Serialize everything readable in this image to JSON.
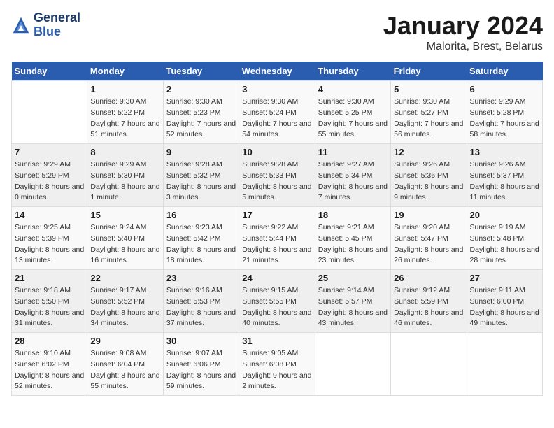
{
  "header": {
    "logo_line1": "General",
    "logo_line2": "Blue",
    "month": "January 2024",
    "location": "Malorita, Brest, Belarus"
  },
  "weekdays": [
    "Sunday",
    "Monday",
    "Tuesday",
    "Wednesday",
    "Thursday",
    "Friday",
    "Saturday"
  ],
  "weeks": [
    [
      {
        "day": "",
        "sunrise": "",
        "sunset": "",
        "daylight": ""
      },
      {
        "day": "1",
        "sunrise": "Sunrise: 9:30 AM",
        "sunset": "Sunset: 5:22 PM",
        "daylight": "Daylight: 7 hours and 51 minutes."
      },
      {
        "day": "2",
        "sunrise": "Sunrise: 9:30 AM",
        "sunset": "Sunset: 5:23 PM",
        "daylight": "Daylight: 7 hours and 52 minutes."
      },
      {
        "day": "3",
        "sunrise": "Sunrise: 9:30 AM",
        "sunset": "Sunset: 5:24 PM",
        "daylight": "Daylight: 7 hours and 54 minutes."
      },
      {
        "day": "4",
        "sunrise": "Sunrise: 9:30 AM",
        "sunset": "Sunset: 5:25 PM",
        "daylight": "Daylight: 7 hours and 55 minutes."
      },
      {
        "day": "5",
        "sunrise": "Sunrise: 9:30 AM",
        "sunset": "Sunset: 5:27 PM",
        "daylight": "Daylight: 7 hours and 56 minutes."
      },
      {
        "day": "6",
        "sunrise": "Sunrise: 9:29 AM",
        "sunset": "Sunset: 5:28 PM",
        "daylight": "Daylight: 7 hours and 58 minutes."
      }
    ],
    [
      {
        "day": "7",
        "sunrise": "Sunrise: 9:29 AM",
        "sunset": "Sunset: 5:29 PM",
        "daylight": "Daylight: 8 hours and 0 minutes."
      },
      {
        "day": "8",
        "sunrise": "Sunrise: 9:29 AM",
        "sunset": "Sunset: 5:30 PM",
        "daylight": "Daylight: 8 hours and 1 minute."
      },
      {
        "day": "9",
        "sunrise": "Sunrise: 9:28 AM",
        "sunset": "Sunset: 5:32 PM",
        "daylight": "Daylight: 8 hours and 3 minutes."
      },
      {
        "day": "10",
        "sunrise": "Sunrise: 9:28 AM",
        "sunset": "Sunset: 5:33 PM",
        "daylight": "Daylight: 8 hours and 5 minutes."
      },
      {
        "day": "11",
        "sunrise": "Sunrise: 9:27 AM",
        "sunset": "Sunset: 5:34 PM",
        "daylight": "Daylight: 8 hours and 7 minutes."
      },
      {
        "day": "12",
        "sunrise": "Sunrise: 9:26 AM",
        "sunset": "Sunset: 5:36 PM",
        "daylight": "Daylight: 8 hours and 9 minutes."
      },
      {
        "day": "13",
        "sunrise": "Sunrise: 9:26 AM",
        "sunset": "Sunset: 5:37 PM",
        "daylight": "Daylight: 8 hours and 11 minutes."
      }
    ],
    [
      {
        "day": "14",
        "sunrise": "Sunrise: 9:25 AM",
        "sunset": "Sunset: 5:39 PM",
        "daylight": "Daylight: 8 hours and 13 minutes."
      },
      {
        "day": "15",
        "sunrise": "Sunrise: 9:24 AM",
        "sunset": "Sunset: 5:40 PM",
        "daylight": "Daylight: 8 hours and 16 minutes."
      },
      {
        "day": "16",
        "sunrise": "Sunrise: 9:23 AM",
        "sunset": "Sunset: 5:42 PM",
        "daylight": "Daylight: 8 hours and 18 minutes."
      },
      {
        "day": "17",
        "sunrise": "Sunrise: 9:22 AM",
        "sunset": "Sunset: 5:44 PM",
        "daylight": "Daylight: 8 hours and 21 minutes."
      },
      {
        "day": "18",
        "sunrise": "Sunrise: 9:21 AM",
        "sunset": "Sunset: 5:45 PM",
        "daylight": "Daylight: 8 hours and 23 minutes."
      },
      {
        "day": "19",
        "sunrise": "Sunrise: 9:20 AM",
        "sunset": "Sunset: 5:47 PM",
        "daylight": "Daylight: 8 hours and 26 minutes."
      },
      {
        "day": "20",
        "sunrise": "Sunrise: 9:19 AM",
        "sunset": "Sunset: 5:48 PM",
        "daylight": "Daylight: 8 hours and 28 minutes."
      }
    ],
    [
      {
        "day": "21",
        "sunrise": "Sunrise: 9:18 AM",
        "sunset": "Sunset: 5:50 PM",
        "daylight": "Daylight: 8 hours and 31 minutes."
      },
      {
        "day": "22",
        "sunrise": "Sunrise: 9:17 AM",
        "sunset": "Sunset: 5:52 PM",
        "daylight": "Daylight: 8 hours and 34 minutes."
      },
      {
        "day": "23",
        "sunrise": "Sunrise: 9:16 AM",
        "sunset": "Sunset: 5:53 PM",
        "daylight": "Daylight: 8 hours and 37 minutes."
      },
      {
        "day": "24",
        "sunrise": "Sunrise: 9:15 AM",
        "sunset": "Sunset: 5:55 PM",
        "daylight": "Daylight: 8 hours and 40 minutes."
      },
      {
        "day": "25",
        "sunrise": "Sunrise: 9:14 AM",
        "sunset": "Sunset: 5:57 PM",
        "daylight": "Daylight: 8 hours and 43 minutes."
      },
      {
        "day": "26",
        "sunrise": "Sunrise: 9:12 AM",
        "sunset": "Sunset: 5:59 PM",
        "daylight": "Daylight: 8 hours and 46 minutes."
      },
      {
        "day": "27",
        "sunrise": "Sunrise: 9:11 AM",
        "sunset": "Sunset: 6:00 PM",
        "daylight": "Daylight: 8 hours and 49 minutes."
      }
    ],
    [
      {
        "day": "28",
        "sunrise": "Sunrise: 9:10 AM",
        "sunset": "Sunset: 6:02 PM",
        "daylight": "Daylight: 8 hours and 52 minutes."
      },
      {
        "day": "29",
        "sunrise": "Sunrise: 9:08 AM",
        "sunset": "Sunset: 6:04 PM",
        "daylight": "Daylight: 8 hours and 55 minutes."
      },
      {
        "day": "30",
        "sunrise": "Sunrise: 9:07 AM",
        "sunset": "Sunset: 6:06 PM",
        "daylight": "Daylight: 8 hours and 59 minutes."
      },
      {
        "day": "31",
        "sunrise": "Sunrise: 9:05 AM",
        "sunset": "Sunset: 6:08 PM",
        "daylight": "Daylight: 9 hours and 2 minutes."
      },
      {
        "day": "",
        "sunrise": "",
        "sunset": "",
        "daylight": ""
      },
      {
        "day": "",
        "sunrise": "",
        "sunset": "",
        "daylight": ""
      },
      {
        "day": "",
        "sunrise": "",
        "sunset": "",
        "daylight": ""
      }
    ]
  ]
}
